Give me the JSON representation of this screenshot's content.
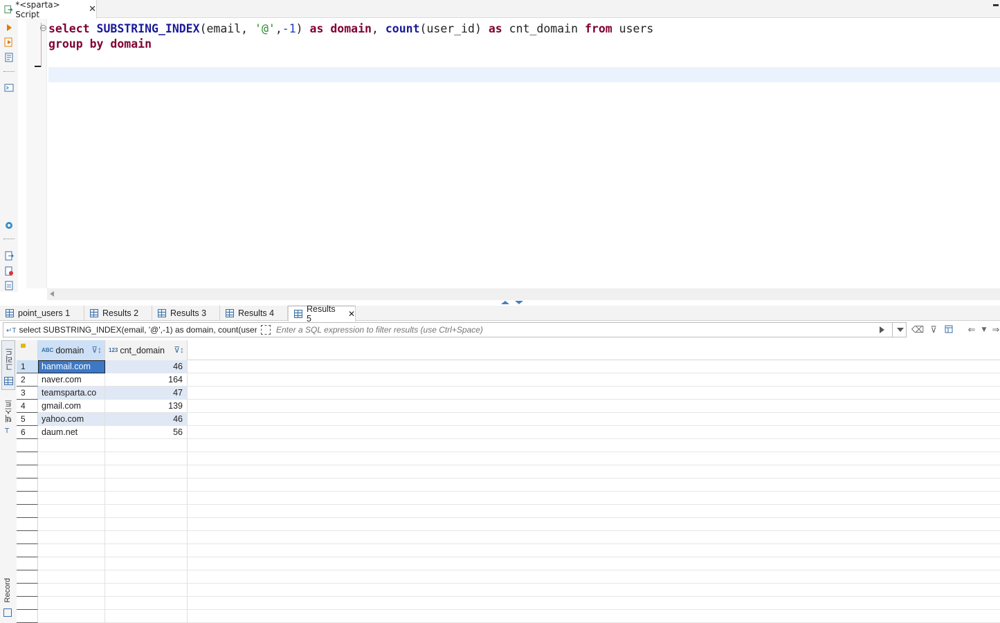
{
  "editor": {
    "tab_title": "*<sparta> Script",
    "code_line1": {
      "t1": "select",
      "t2": " ",
      "t3": "SUBSTRING_INDEX",
      "t4": "(email, ",
      "t5": "'@'",
      "t6": ",",
      "t7": "-1",
      "t8": ") ",
      "t9": "as",
      "t10": " ",
      "t11": "domain",
      "t12": ", ",
      "t13": "count",
      "t14": "(user_id) ",
      "t15": "as",
      "t16": " cnt_domain ",
      "t17": "from",
      "t18": " users"
    },
    "code_line2": {
      "t1": "group by",
      "t2": " ",
      "t3": "domain"
    }
  },
  "results": {
    "tabs": [
      {
        "label": "point_users 1"
      },
      {
        "label": "Results 2"
      },
      {
        "label": "Results 3"
      },
      {
        "label": "Results 4"
      },
      {
        "label": "Results 5"
      }
    ],
    "active_tab_index": 4,
    "query_text": "select SUBSTRING_INDEX(email, '@',-1) as domain, count(user_",
    "filter_placeholder": "Enter a SQL expression to filter results (use Ctrl+Space)",
    "side_tabs": {
      "grid": "그리드",
      "text": "텍스트",
      "record": "Record"
    },
    "columns": [
      {
        "type": "ABC",
        "name": "domain"
      },
      {
        "type": "123",
        "name": "cnt_domain"
      }
    ],
    "rows": [
      {
        "num": "1",
        "domain": "hanmail.com",
        "cnt_domain": "46"
      },
      {
        "num": "2",
        "domain": "naver.com",
        "cnt_domain": "164"
      },
      {
        "num": "3",
        "domain": "teamsparta.co",
        "cnt_domain": "47"
      },
      {
        "num": "4",
        "domain": "gmail.com",
        "cnt_domain": "139"
      },
      {
        "num": "5",
        "domain": "yahoo.com",
        "cnt_domain": "46"
      },
      {
        "num": "6",
        "domain": "daum.net",
        "cnt_domain": "56"
      }
    ]
  },
  "colors": {
    "keyword": "#7f0032",
    "function": "#1a1a9a",
    "string": "#2a8a2a",
    "selection": "#3c78c6",
    "accent": "#3a6ea5"
  }
}
